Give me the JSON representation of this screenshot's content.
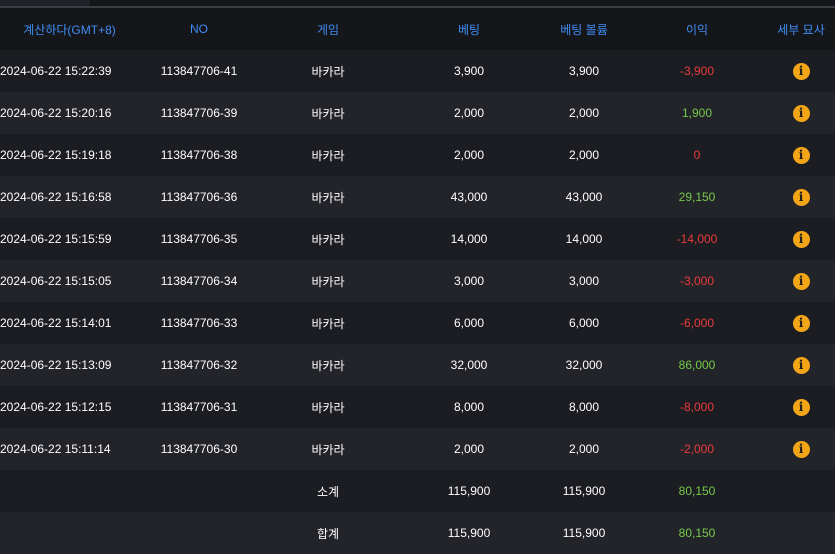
{
  "headers": {
    "time": "계산하다(GMT+8)",
    "no": "NO",
    "game": "게임",
    "bet": "베팅",
    "volume": "베팅 볼륨",
    "profit": "이익",
    "detail": "세부 묘사"
  },
  "rows": [
    {
      "time": "2024-06-22 15:22:39",
      "no": "113847706-41",
      "game": "바카라",
      "bet": "3,900",
      "volume": "3,900",
      "profit": "-3,900",
      "profit_sign": "neg"
    },
    {
      "time": "2024-06-22 15:20:16",
      "no": "113847706-39",
      "game": "바카라",
      "bet": "2,000",
      "volume": "2,000",
      "profit": "1,900",
      "profit_sign": "pos"
    },
    {
      "time": "2024-06-22 15:19:18",
      "no": "113847706-38",
      "game": "바카라",
      "bet": "2,000",
      "volume": "2,000",
      "profit": "0",
      "profit_sign": "zero"
    },
    {
      "time": "2024-06-22 15:16:58",
      "no": "113847706-36",
      "game": "바카라",
      "bet": "43,000",
      "volume": "43,000",
      "profit": "29,150",
      "profit_sign": "pos"
    },
    {
      "time": "2024-06-22 15:15:59",
      "no": "113847706-35",
      "game": "바카라",
      "bet": "14,000",
      "volume": "14,000",
      "profit": "-14,000",
      "profit_sign": "neg"
    },
    {
      "time": "2024-06-22 15:15:05",
      "no": "113847706-34",
      "game": "바카라",
      "bet": "3,000",
      "volume": "3,000",
      "profit": "-3,000",
      "profit_sign": "neg"
    },
    {
      "time": "2024-06-22 15:14:01",
      "no": "113847706-33",
      "game": "바카라",
      "bet": "6,000",
      "volume": "6,000",
      "profit": "-6,000",
      "profit_sign": "neg"
    },
    {
      "time": "2024-06-22 15:13:09",
      "no": "113847706-32",
      "game": "바카라",
      "bet": "32,000",
      "volume": "32,000",
      "profit": "86,000",
      "profit_sign": "pos"
    },
    {
      "time": "2024-06-22 15:12:15",
      "no": "113847706-31",
      "game": "바카라",
      "bet": "8,000",
      "volume": "8,000",
      "profit": "-8,000",
      "profit_sign": "neg"
    },
    {
      "time": "2024-06-22 15:11:14",
      "no": "113847706-30",
      "game": "바카라",
      "bet": "2,000",
      "volume": "2,000",
      "profit": "-2,000",
      "profit_sign": "neg"
    }
  ],
  "subtotal": {
    "label": "소계",
    "bet": "115,900",
    "volume": "115,900",
    "profit": "80,150"
  },
  "total": {
    "label": "합계",
    "bet": "115,900",
    "volume": "115,900",
    "profit": "80,150"
  },
  "info_icon": {
    "name": "info-icon",
    "glyph": "i"
  },
  "colors": {
    "header": "#3f8df5",
    "negative": "#ea3b3b",
    "positive": "#74c94a",
    "info": "#f2a516"
  }
}
